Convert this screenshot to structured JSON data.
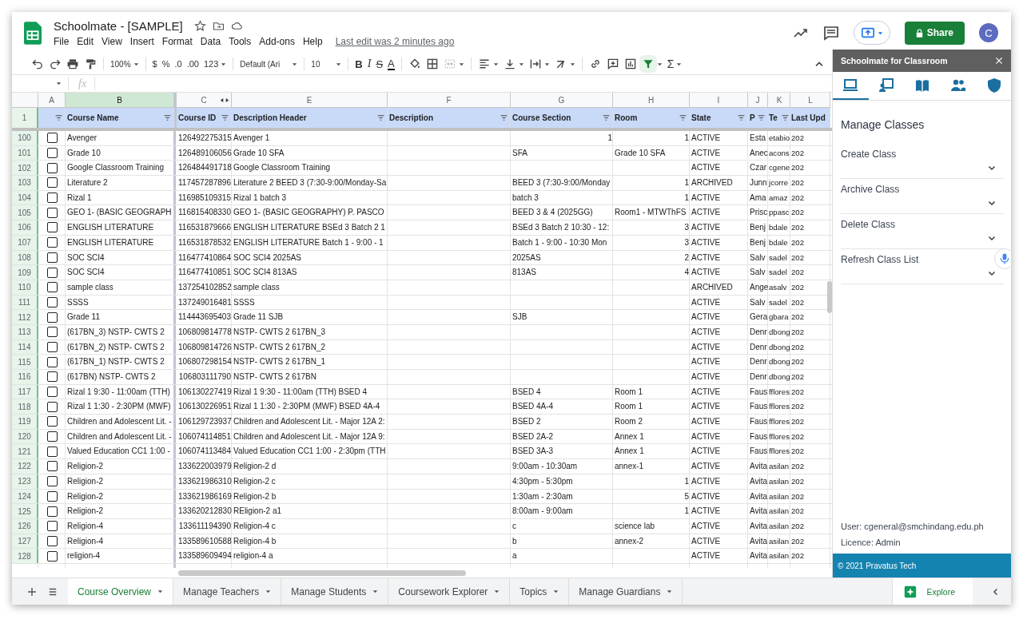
{
  "app": {
    "title": "Schoolmate - [SAMPLE]",
    "menu": [
      "File",
      "Edit",
      "View",
      "Insert",
      "Format",
      "Data",
      "Tools",
      "Add-ons",
      "Help"
    ],
    "last_edit": "Last edit was 2 minutes ago",
    "share": "Share",
    "avatar": "C"
  },
  "toolbar": {
    "filter_active": true,
    "items": [
      {
        "kind": "zoom",
        "text": "100%"
      },
      {
        "kind": "currency",
        "text": "$"
      },
      {
        "kind": "percent",
        "text": "%"
      },
      {
        "kind": "decrease-decimal",
        "text": ".0"
      },
      {
        "kind": "increase-decimal",
        "text": ".00"
      },
      {
        "kind": "number-format",
        "text": "123"
      },
      {
        "kind": "font",
        "text": "Default (Ari"
      },
      {
        "kind": "font-size",
        "text": "10"
      },
      {
        "kind": "bold",
        "text": "B"
      },
      {
        "kind": "italic",
        "text": "I"
      },
      {
        "kind": "strikethrough",
        "text": "S"
      },
      {
        "kind": "text-color",
        "text": "A"
      },
      {
        "kind": "functions",
        "text": "Σ"
      }
    ]
  },
  "formula_bar": {
    "fx": "fx"
  },
  "sheet": {
    "header_row_number": "1",
    "columns": [
      {
        "letter": "A",
        "selected": false
      },
      {
        "letter": "B",
        "selected": true,
        "header": "Course Name"
      },
      {
        "letter": "C",
        "selected": false,
        "header": "Course ID"
      },
      {
        "letter": "E",
        "selected": false,
        "header": "Description Header"
      },
      {
        "letter": "F",
        "selected": false,
        "header": "Description"
      },
      {
        "letter": "G",
        "selected": false,
        "header": "Course Section"
      },
      {
        "letter": "H",
        "selected": false,
        "header": "Room"
      },
      {
        "letter": "I",
        "selected": false,
        "header": "State"
      },
      {
        "letter": "J",
        "selected": false,
        "header": "P"
      },
      {
        "letter": "K",
        "selected": false,
        "header": "Te"
      },
      {
        "letter": "L",
        "selected": false,
        "header": "Last Upd"
      }
    ],
    "rows": [
      {
        "number": "100",
        "checked": false,
        "course_name": "Avenger",
        "course_id": "126492275315",
        "description_header": "Avenger 1",
        "course_section_number": "1",
        "room_number": "1",
        "state": "ACTIVE",
        "column_j": "Esta",
        "column_k": "etabio",
        "column_l": "202"
      },
      {
        "number": "101",
        "checked": false,
        "course_name": "Grade 10",
        "course_id": "126489106056",
        "description_header": "Grade 10 SFA",
        "course_section": "SFA",
        "room": "Grade 10 SFA",
        "state": "ACTIVE",
        "column_j": "Anec",
        "column_k": "acons",
        "column_l": "202"
      },
      {
        "number": "102",
        "checked": false,
        "course_name": "Google Classroom Training",
        "course_id": "126484491718",
        "description_header": "Google Classroom Training",
        "state": "ACTIVE",
        "column_j": "Czar",
        "column_k": "cgene",
        "column_l": "202"
      },
      {
        "number": "103",
        "checked": false,
        "course_name": "Literature 2",
        "course_id": "117457287896",
        "description_header": "Literature 2 BEED 3 (7:30-9:00/Monday-Sa",
        "course_section": "BEED 3 (7:30-9:00/Monday",
        "room_number": "1",
        "state": "ARCHIVED",
        "column_j": "Junn",
        "column_k": "jcorre",
        "column_l": "202"
      },
      {
        "number": "104",
        "checked": false,
        "course_name": "Rizal 1",
        "course_id": "116985109315",
        "description_header": "Rizal 1 batch 3",
        "course_section": "batch 3",
        "room_number": "1",
        "state": "ACTIVE",
        "column_j": "Ama",
        "column_k": "amaz",
        "column_l": "202"
      },
      {
        "number": "105",
        "checked": false,
        "course_name": "GEO 1- (BASIC GEOGRAPH",
        "course_id": "116815408330",
        "description_header": "GEO 1- (BASIC GEOGRAPHY) P. PASCO",
        "course_section": "BEED 3 & 4 (2025GG)",
        "room": "Room1 - MTWThFS",
        "state": "ACTIVE",
        "column_j": "Prisc",
        "column_k": "ppasc",
        "column_l": "202"
      },
      {
        "number": "106",
        "checked": false,
        "course_name": "ENGLISH LITERATURE",
        "course_id": "116531879666",
        "description_header": "ENGLISH LITERATURE BSEd 3 Batch 2 1",
        "course_section": "BSEd 3 Batch 2 10:30 - 12:",
        "room_number": "3",
        "state": "ACTIVE",
        "column_j": "Benj",
        "column_k": "bdale",
        "column_l": "202"
      },
      {
        "number": "107",
        "checked": false,
        "course_name": "ENGLISH LITERATURE",
        "course_id": "116531878532",
        "description_header": "ENGLISH LITERATURE Batch 1 - 9:00 - 1",
        "course_section": "Batch 1 - 9:00 - 10:30  Mon",
        "room_number": "3",
        "state": "ACTIVE",
        "column_j": "Benj",
        "column_k": "bdale",
        "column_l": "202"
      },
      {
        "number": "108",
        "checked": false,
        "course_name": "SOC SCI4",
        "course_id": "116477410864",
        "description_header": "SOC SCI4 2025AS",
        "course_section": "2025AS",
        "room_number": "2",
        "state": "ACTIVE",
        "column_j": "Salv",
        "column_k": "sadel",
        "column_l": "202"
      },
      {
        "number": "109",
        "checked": false,
        "course_name": "SOC SCI4",
        "course_id": "116477410851",
        "description_header": "SOC SCI4 813AS",
        "course_section": "813AS",
        "room_number": "4",
        "state": "ACTIVE",
        "column_j": "Salv",
        "column_k": "sadel",
        "column_l": "202"
      },
      {
        "number": "110",
        "checked": false,
        "course_name": "sample class",
        "course_id": "137254102852",
        "description_header": "sample class",
        "state": "ARCHIVED",
        "column_j": "Ange",
        "column_k": "asalv",
        "column_l": "202"
      },
      {
        "number": "111",
        "checked": false,
        "course_name": "SSSS",
        "course_id": "137249016481",
        "description_header": "SSSS",
        "state": "ACTIVE",
        "column_j": "Salv",
        "column_k": "sadel",
        "column_l": "202"
      },
      {
        "number": "112",
        "checked": false,
        "course_name": "Grade 11",
        "course_id": "114443695403",
        "description_header": "Grade 11 SJB",
        "course_section": "SJB",
        "state": "ACTIVE",
        "column_j": "Gera",
        "column_k": "gbara",
        "column_l": "202"
      },
      {
        "number": "113",
        "checked": false,
        "course_name": "(617BN_3) NSTP- CWTS 2",
        "course_id": "106809814778",
        "description_header": "NSTP- CWTS 2 617BN_3",
        "state": "ACTIVE",
        "column_j": "Denr",
        "column_k": "dbong",
        "column_l": "202"
      },
      {
        "number": "114",
        "checked": false,
        "course_name": "(617BN_2) NSTP- CWTS 2",
        "course_id": "106809814726",
        "description_header": "NSTP- CWTS 2 617BN_2",
        "state": "ACTIVE",
        "column_j": "Denr",
        "column_k": "dbong",
        "column_l": "202"
      },
      {
        "number": "115",
        "checked": false,
        "course_name": "(617BN_1) NSTP- CWTS 2",
        "course_id": "106807298154",
        "description_header": "NSTP- CWTS 2 617BN_1",
        "state": "ACTIVE",
        "column_j": "Denr",
        "column_k": "dbong",
        "column_l": "202"
      },
      {
        "number": "116",
        "checked": false,
        "course_name": "(617BN) NSTP- CWTS 2",
        "course_id": "106803111790",
        "description_header": "NSTP- CWTS 2 617BN",
        "state": "ACTIVE",
        "column_j": "Denr",
        "column_k": "dbong",
        "column_l": "202"
      },
      {
        "number": "117",
        "checked": false,
        "course_name": "Rizal 1  9:30 - 11:00am (TTH)",
        "course_id": "106130227419",
        "description_header": "Rizal 1  9:30 - 11:00am (TTH) BSED 4",
        "course_section": "BSED 4",
        "room": "Room 1",
        "state": "ACTIVE",
        "column_j": "Faus",
        "column_k": "fflores",
        "column_l": "202"
      },
      {
        "number": "118",
        "checked": false,
        "course_name": "Rizal 1 1:30 - 2:30PM (MWF)",
        "course_id": "106130226951",
        "description_header": "Rizal 1 1:30 - 2:30PM (MWF) BSED 4A-4",
        "course_section": "BSED 4A-4",
        "room": "Room 1",
        "state": "ACTIVE",
        "column_j": "Faus",
        "column_k": "fflores",
        "column_l": "202"
      },
      {
        "number": "119",
        "checked": false,
        "course_name": "Children and Adolescent Lit. -",
        "course_id": "106129723937",
        "description_header": "Children and Adolescent Lit. - Major 12A 2:",
        "course_section": "BSED 2",
        "room": "Room 2",
        "state": "ACTIVE",
        "column_j": "Faus",
        "column_k": "fflores",
        "column_l": "202"
      },
      {
        "number": "120",
        "checked": false,
        "course_name": "Children and Adolescent Lit. -",
        "course_id": "106074114851",
        "description_header": "Children and Adolescent Lit. - Major 12A 9:",
        "course_section": "BSED 2A-2",
        "room": "Annex 1",
        "state": "ACTIVE",
        "column_j": "Faus",
        "column_k": "fflores",
        "column_l": "202"
      },
      {
        "number": "121",
        "checked": false,
        "course_name": "Valued Education CC1 1:00 -",
        "course_id": "106074113484",
        "description_header": "Valued Education CC1 1:00 - 2:30pm (TTH",
        "course_section": "BSED 3A-3",
        "room": "Annex 1",
        "state": "ACTIVE",
        "column_j": "Faus",
        "column_k": "fflores",
        "column_l": "202"
      },
      {
        "number": "122",
        "checked": false,
        "course_name": "Religion-2",
        "course_id": "133622003979",
        "description_header": "Religion-2 d",
        "course_section": "9:00am - 10:30am",
        "room": "annex-1",
        "state": "ACTIVE",
        "column_j": "Avita",
        "column_k": "asilan",
        "column_l": "202"
      },
      {
        "number": "123",
        "checked": false,
        "course_name": "Religion-2",
        "course_id": "133621986310",
        "description_header": "Religion-2 c",
        "course_section": "4:30pm - 5:30pm",
        "room_number": "1",
        "state": "ACTIVE",
        "column_j": "Avita",
        "column_k": "asilan",
        "column_l": "202"
      },
      {
        "number": "124",
        "checked": false,
        "course_name": "Religion-2",
        "course_id": "133621986169",
        "description_header": "Religion-2 b",
        "course_section": "1:30am - 2:30am",
        "room_number": "5",
        "state": "ACTIVE",
        "column_j": "Avita",
        "column_k": "asilan",
        "column_l": "202"
      },
      {
        "number": "125",
        "checked": false,
        "course_name": "Religion-2",
        "course_id": "133620212830",
        "description_header": "REligion-2 a1",
        "course_section": "8:00am - 9:00am",
        "room_number": "1",
        "state": "ACTIVE",
        "column_j": "Avita",
        "column_k": "asilan",
        "column_l": "202"
      },
      {
        "number": "126",
        "checked": false,
        "course_name": "Religion-4",
        "course_id": "133611194390",
        "description_header": "Religion-4 c",
        "course_section": "c",
        "room": "science lab",
        "state": "ACTIVE",
        "column_j": "Avita",
        "column_k": "asilan",
        "column_l": "202"
      },
      {
        "number": "127",
        "checked": false,
        "course_name": "Religion-4",
        "course_id": "133589610588",
        "description_header": "Religion-4 b",
        "course_section": "b",
        "room": "annex-2",
        "state": "ACTIVE",
        "column_j": "Avita",
        "column_k": "asilan",
        "column_l": "202"
      },
      {
        "number": "128",
        "checked": false,
        "course_name": "religion-4",
        "course_id": "133589609494",
        "description_header": "religion-4 a",
        "course_section": "a",
        "state": "ACTIVE",
        "column_j": "Avita",
        "column_k": "asilan",
        "column_l": "202"
      }
    ]
  },
  "sheet_tabs": [
    {
      "label": "Course Overview",
      "selected": true
    },
    {
      "label": "Manage Teachers",
      "selected": false
    },
    {
      "label": "Manage Students",
      "selected": false
    },
    {
      "label": "Coursework Explorer",
      "selected": false
    },
    {
      "label": "Topics",
      "selected": false
    },
    {
      "label": "Manage Guardians",
      "selected": false
    }
  ],
  "explore": "Explore",
  "side_panel": {
    "title": "Schoolmate for Classroom",
    "tabs": [
      {
        "selected": true
      },
      {
        "selected": false
      },
      {
        "selected": false
      },
      {
        "selected": false
      },
      {
        "selected": false
      }
    ],
    "heading": "Manage Classes",
    "sections": [
      {
        "label": "Create Class",
        "expanded": false
      },
      {
        "label": "Archive Class",
        "expanded": false
      },
      {
        "label": "Delete Class",
        "expanded": false
      },
      {
        "label": "Refresh Class List",
        "expanded": false
      }
    ],
    "user": "User: cgeneral@smchindang.edu.ph",
    "licence": "Licence: Admin",
    "copyright": "© 2021 Pravatus Tech"
  }
}
